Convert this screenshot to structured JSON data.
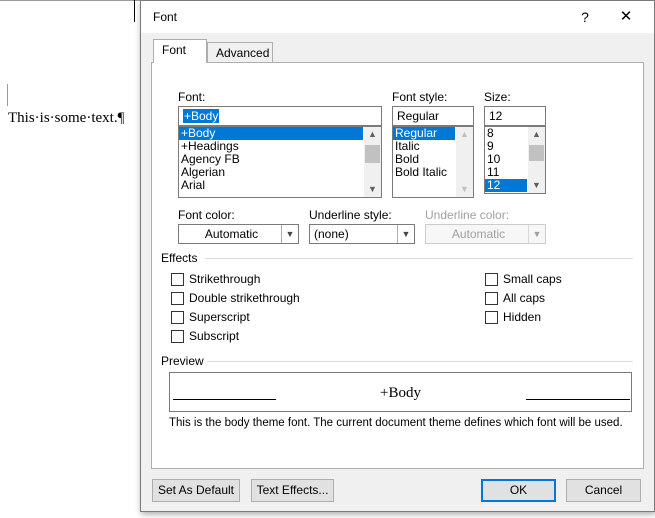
{
  "document": {
    "text": "This·is·some·text.¶"
  },
  "dialog": {
    "title": "Font",
    "help_label": "?",
    "close_label": "✕",
    "tabs": [
      {
        "label": "Font"
      },
      {
        "label": "Advanced"
      }
    ],
    "font": {
      "label": "Font:",
      "value": "+Body",
      "items": [
        "+Body",
        "+Headings",
        "Agency FB",
        "Algerian",
        "Arial"
      ],
      "selected": "+Body"
    },
    "font_style": {
      "label": "Font style:",
      "value": "Regular",
      "items": [
        "Regular",
        "Italic",
        "Bold",
        "Bold Italic"
      ],
      "selected": "Regular"
    },
    "size": {
      "label": "Size:",
      "value": "12",
      "items": [
        "8",
        "9",
        "10",
        "11",
        "12"
      ],
      "selected": "12"
    },
    "font_color": {
      "label": "Font color:",
      "value": "Automatic"
    },
    "underline_style": {
      "label": "Underline style:",
      "value": "(none)"
    },
    "underline_color": {
      "label": "Underline color:",
      "value": "Automatic"
    },
    "effects": {
      "label": "Effects",
      "left": [
        {
          "label": "Strikethrough"
        },
        {
          "label": "Double strikethrough"
        },
        {
          "label": "Superscript"
        },
        {
          "label": "Subscript"
        }
      ],
      "right": [
        {
          "label": "Small caps"
        },
        {
          "label": "All caps"
        },
        {
          "label": "Hidden"
        }
      ]
    },
    "preview": {
      "label": "Preview",
      "sample": "+Body",
      "description": "This is the body theme font. The current document theme defines which font will be used."
    },
    "buttons": {
      "set_default": "Set As Default",
      "text_effects": "Text Effects...",
      "ok": "OK",
      "cancel": "Cancel"
    },
    "colors": {
      "selection": "#0078d7",
      "dialog_bg": "#f0f0f0",
      "default_button_border": "#0078d7"
    }
  }
}
